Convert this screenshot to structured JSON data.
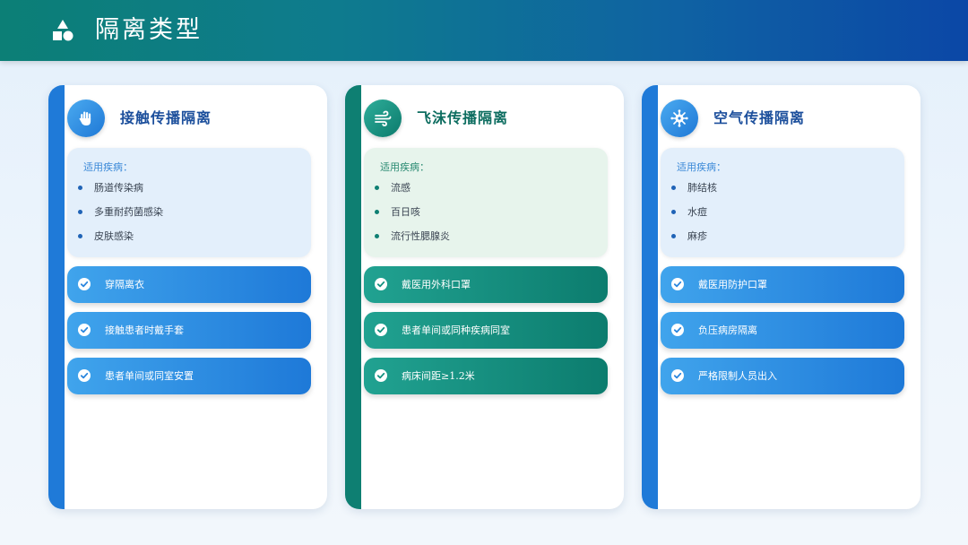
{
  "header": {
    "title": "隔离类型",
    "icon": "shapes-icon"
  },
  "colors": {
    "blue_accent": "#1f7ad8",
    "teal_accent": "#0e7f72",
    "blue_title": "#1c4f9c",
    "teal_title": "#0d6d60"
  },
  "cards": [
    {
      "title": "接触传播隔离",
      "icon": "hand-icon",
      "disease_label": "适用疾病：",
      "diseases": [
        "肠道传染病",
        "多重耐药菌感染",
        "皮肤感染"
      ],
      "measures": [
        "穿隔离衣",
        "接触患者时戴手套",
        "患者单间或同室安置"
      ]
    },
    {
      "title": "飞沫传播隔离",
      "icon": "wind-icon",
      "disease_label": "适用疾病：",
      "diseases": [
        "流感",
        "百日咳",
        "流行性腮腺炎"
      ],
      "measures": [
        "戴医用外科口罩",
        "患者单间或同种疾病同室",
        "病床间距≥1.2米"
      ]
    },
    {
      "title": "空气传播隔离",
      "icon": "virus-icon",
      "disease_label": "适用疾病：",
      "diseases": [
        "肺结核",
        "水痘",
        "麻疹"
      ],
      "measures": [
        "戴医用防护口罩",
        "负压病房隔离",
        "严格限制人员出入"
      ]
    }
  ]
}
